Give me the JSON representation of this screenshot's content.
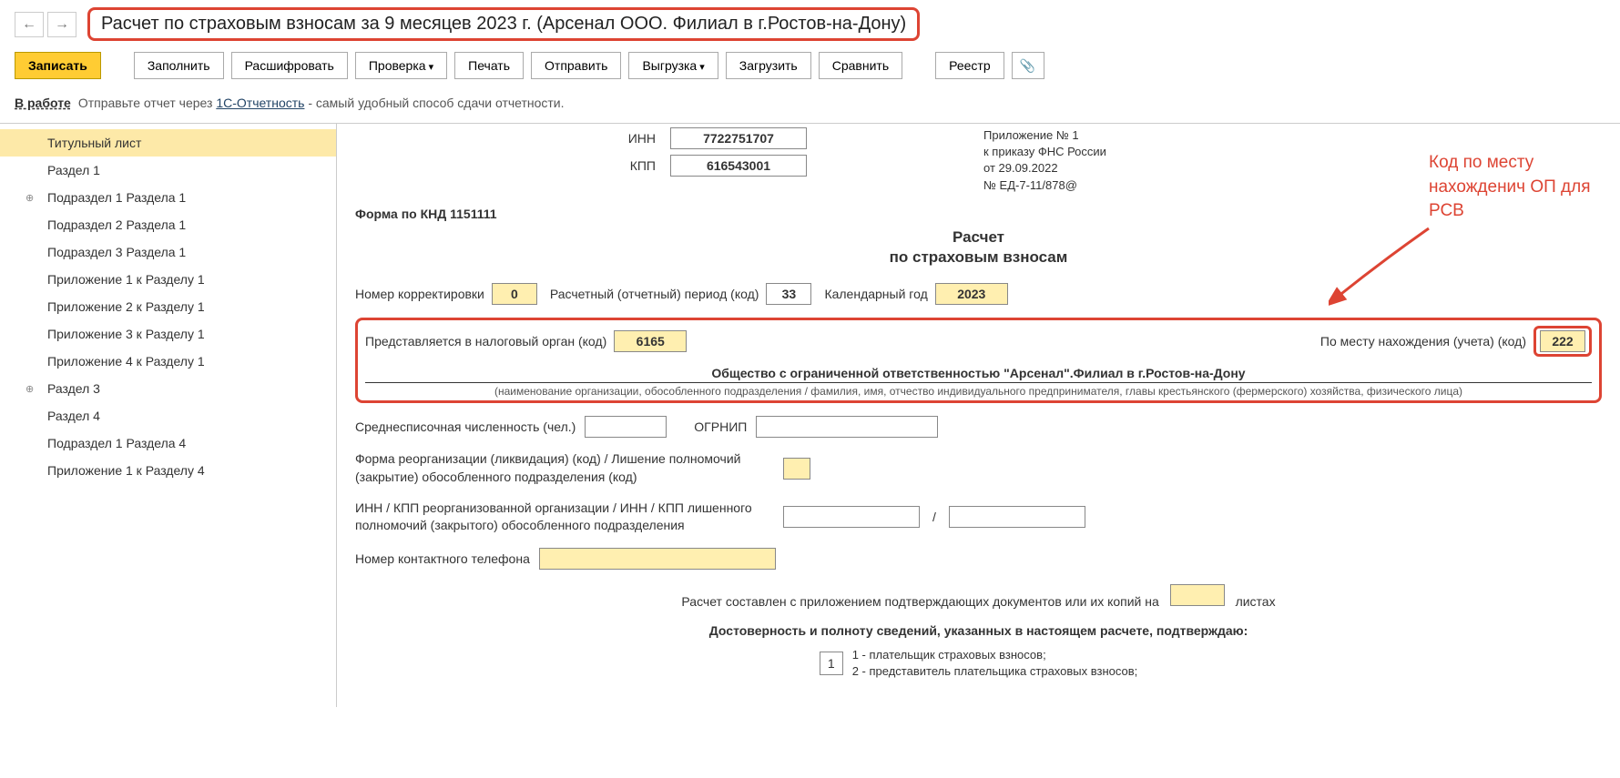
{
  "title": "Расчет по страховым взносам за 9 месяцев 2023 г. (Арсенал ООО. Филиал в г.Ростов-на-Дону)",
  "toolbar": {
    "write": "Записать",
    "fill": "Заполнить",
    "decrypt": "Расшифровать",
    "check": "Проверка",
    "print": "Печать",
    "send": "Отправить",
    "export": "Выгрузка",
    "import": "Загрузить",
    "compare": "Сравнить",
    "registry": "Реестр"
  },
  "status": {
    "state": "В работе",
    "text1": "Отправьте отчет через ",
    "link": "1С-Отчетность",
    "text2": " - самый удобный способ сдачи отчетности."
  },
  "sidebar": {
    "items": [
      {
        "label": "Титульный лист",
        "active": true
      },
      {
        "label": "Раздел 1"
      },
      {
        "label": "Подраздел 1 Раздела 1",
        "exp": true
      },
      {
        "label": "Подраздел 2 Раздела 1"
      },
      {
        "label": "Подраздел 3 Раздела 1"
      },
      {
        "label": "Приложение 1 к Разделу 1"
      },
      {
        "label": "Приложение 2 к Разделу 1"
      },
      {
        "label": "Приложение 3 к Разделу 1"
      },
      {
        "label": "Приложение 4 к Разделу 1"
      },
      {
        "label": "Раздел 3",
        "exp": true
      },
      {
        "label": "Раздел 4"
      },
      {
        "label": "Подраздел 1 Раздела 4"
      },
      {
        "label": "Приложение 1 к Разделу 4"
      }
    ]
  },
  "form": {
    "inn_label": "ИНН",
    "inn": "7722751707",
    "kpp_label": "КПП",
    "kpp": "616543001",
    "app_line1": "Приложение № 1",
    "app_line2": "к приказу ФНС России",
    "app_line3": "от 29.09.2022",
    "app_line4": "№ ЕД-7-11/878@",
    "knd": "Форма по КНД 1151111",
    "title1": "Расчет",
    "title2": "по страховым взносам",
    "corr_label": "Номер корректировки",
    "corr": "0",
    "period_label": "Расчетный (отчетный) период (код)",
    "period": "33",
    "year_label": "Календарный год",
    "year": "2023",
    "tax_org_label": "Представляется в налоговый орган (код)",
    "tax_org": "6165",
    "place_label": "По месту нахождения (учета) (код)",
    "place": "222",
    "org_name": "Общество с ограниченной ответственностью \"Арсенал\".Филиал в г.Ростов-на-Дону",
    "org_note": "(наименование организации, обособленного подразделения / фамилия, имя, отчество индивидуального предпринимателя, главы крестьянского (фермерского) хозяйства, физического лица)",
    "avg_label": "Среднесписочная численность (чел.)",
    "ogrnip_label": "ОГРНИП",
    "reorg_label": "Форма реорганизации (ликвидация) (код) / Лишение полномочий (закрытие) обособленного подразделения (код)",
    "reorg_inn_label": "ИНН / КПП реорганизованной организации / ИНН / КПП лишенного полномочий (закрытого) обособленного подразделения",
    "phone_label": "Номер контактного телефона",
    "docs_text1": "Расчет составлен с приложением подтверждающих документов или их копий на",
    "docs_text2": "листах",
    "confirm_title": "Достоверность и полноту сведений, указанных в настоящем расчете, подтверждаю:",
    "opt_val": "1",
    "opt1": "1 - плательщик страховых взносов;",
    "opt2": "2 - представитель плательщика страховых взносов;"
  },
  "annotation": "Код по месту нахожденич ОП для РСВ"
}
